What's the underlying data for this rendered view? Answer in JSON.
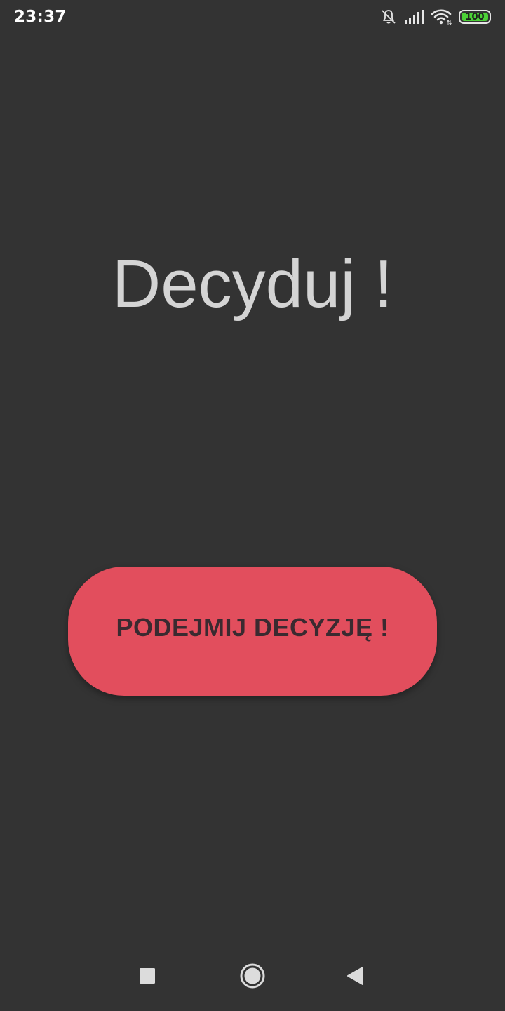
{
  "status_bar": {
    "time": "23:37",
    "battery_level": "100",
    "icons": [
      "bell-off-icon",
      "signal-icon",
      "wifi-icon",
      "battery-icon"
    ],
    "battery_color": "#4cd137"
  },
  "main": {
    "title": "Decyduj !",
    "button_label": "PODEJMIJ DECYZJĘ !",
    "button_color": "#e24e5d",
    "background_color": "#333333"
  },
  "nav_bar": {
    "icons": [
      "recents-icon",
      "home-icon",
      "back-icon"
    ]
  }
}
